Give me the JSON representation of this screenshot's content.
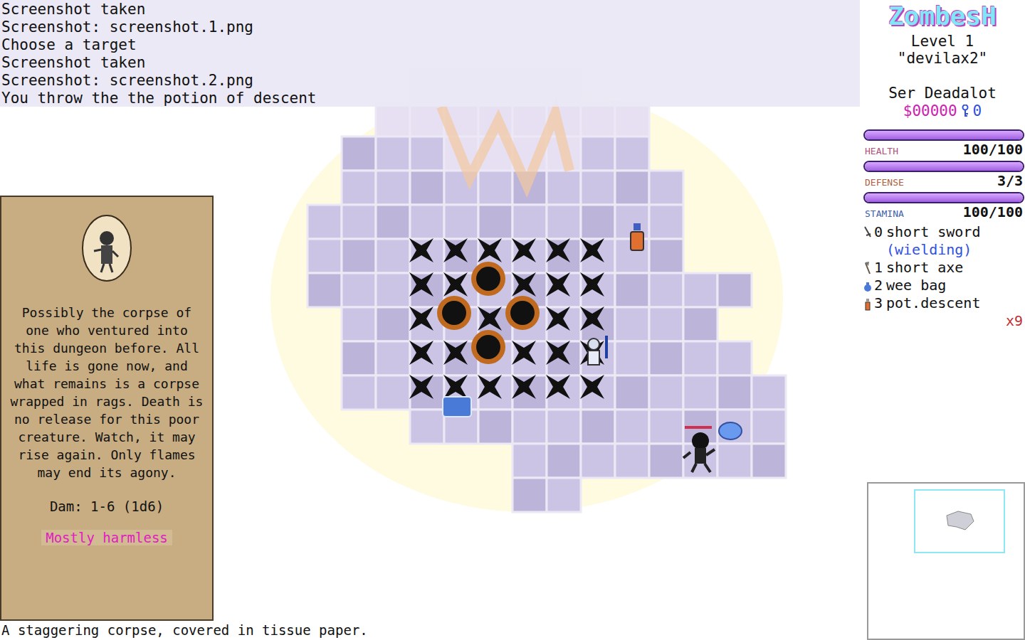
{
  "log": {
    "lines": [
      "Screenshot taken",
      "Screenshot: screenshot.1.png",
      "Choose a target",
      "Screenshot taken",
      "Screenshot: screenshot.2.png",
      "You throw the the potion of descent"
    ]
  },
  "sidebar": {
    "logo": "ZombesH",
    "level": "Level 1",
    "level_name": "\"devilax2\"",
    "character": "Ser Deadalot",
    "gold": "$00000",
    "keys": "0",
    "stats": [
      {
        "label": "HEALTH",
        "value": "100/100",
        "level": 1,
        "color": "#b0507a"
      },
      {
        "label": "DEFENSE",
        "value": "3/3",
        "level": 1,
        "color": "#b06040"
      },
      {
        "label": "STAMINA",
        "value": "100/100",
        "level": 1,
        "color": "#4060a8"
      }
    ],
    "inventory": [
      {
        "key": "0",
        "name": "short sword",
        "note": "(wielding)",
        "kind": "sword"
      },
      {
        "key": "1",
        "name": "short axe",
        "note": "",
        "kind": "axe"
      },
      {
        "key": "2",
        "name": "wee bag",
        "note": "",
        "kind": "bag"
      },
      {
        "key": "3",
        "name": "pot.descent",
        "note": "",
        "kind": "potion"
      }
    ],
    "count": "x9"
  },
  "info_card": {
    "description": "Possibly the corpse of one who ventured into this dungeon before. All life is gone now, and what remains is a corpse wrapped in rags. Death is no release for this poor creature. Watch, it may rise again. Only flames may end its agony.",
    "damage": "Dam: 1-6 (1d6)",
    "threat": "Mostly harmless"
  },
  "status_bar": "A staggering corpse, covered in tissue paper.",
  "map": {
    "enemy_health": 1
  }
}
